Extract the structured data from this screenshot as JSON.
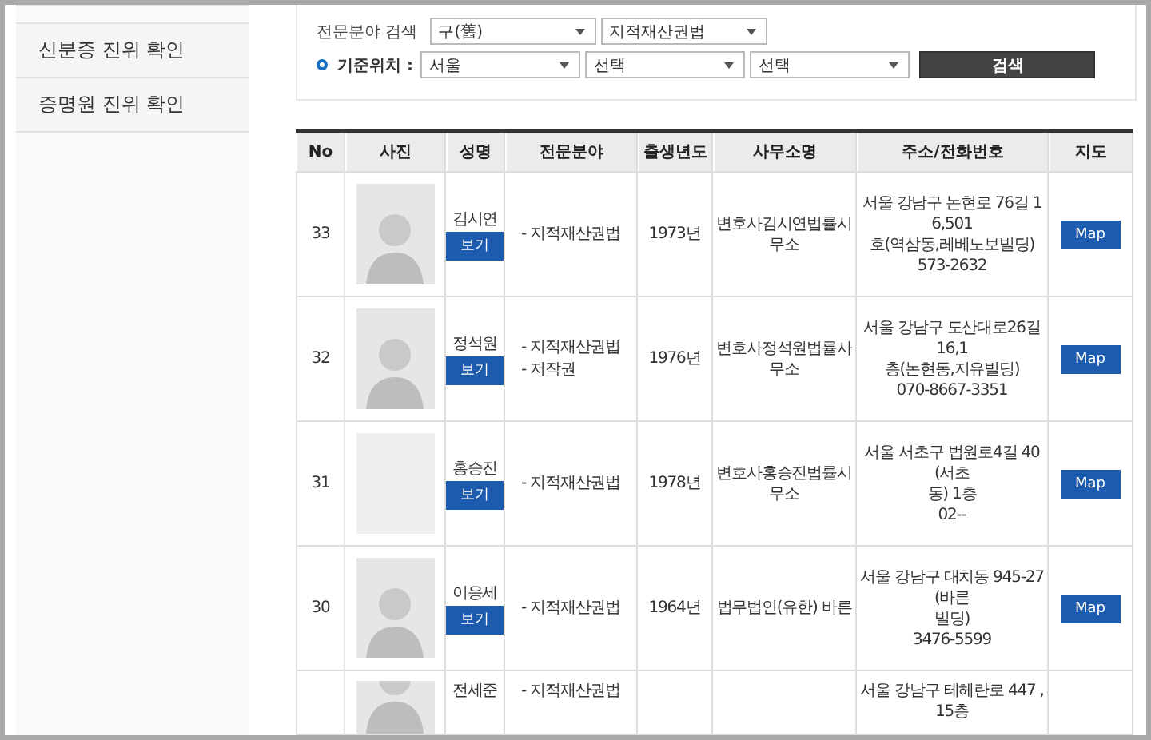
{
  "sidebar": {
    "items": [
      {
        "label": "신분증 진위 확인"
      },
      {
        "label": "증명원 진위 확인"
      }
    ]
  },
  "search": {
    "row_1": {
      "label": "전문분야 검색",
      "selects": [
        {
          "value": "구(舊)"
        },
        {
          "value": "지적재산권법"
        }
      ]
    },
    "row_2": {
      "label": "기준위치 :",
      "selects": [
        {
          "value": "서울"
        },
        {
          "value": "선택"
        },
        {
          "value": "선택"
        }
      ],
      "button": "검색"
    }
  },
  "table": {
    "columns": [
      "No",
      "사진",
      "성명",
      "전문분야",
      "출생년도",
      "사무소명",
      "주소/전화번호",
      "지도"
    ],
    "rows": [
      {
        "no": "33",
        "kind": "portrait",
        "name": "김시연",
        "view": "보기",
        "fields": [
          "-  지적재산권법"
        ],
        "year": "1973년",
        "office": "변호사김시연법률시무소",
        "address": [
          "서울 강남구 논현로 76길 16,501",
          "호(역삼동,레베노보빌딩)",
          "573-2632"
        ],
        "map": "Map"
      },
      {
        "no": "32",
        "kind": "portrait",
        "name": "정석원",
        "view": "보기",
        "fields": [
          "-  지적재산권법",
          "-  저작권"
        ],
        "year": "1976년",
        "office": "변호사정석원법률사무소",
        "address": [
          "서울 강남구 도산대로26길 16,1",
          "층(논현동,지유빌딩)",
          "070-8667-3351"
        ],
        "map": "Map"
      },
      {
        "no": "31",
        "kind": "logo",
        "name": "홍승진",
        "view": "보기",
        "fields": [
          "-  지적재산권법"
        ],
        "year": "1978년",
        "office": "변호사홍승진법률시무소",
        "address": [
          "서울 서초구 법원로4길 40 (서초",
          "동) 1층",
          "02--"
        ],
        "map": "Map"
      },
      {
        "no": "30",
        "kind": "portrait",
        "name": "이응세",
        "view": "보기",
        "fields": [
          "-  지적재산권법"
        ],
        "year": "1964년",
        "office": "법무법인(유한) 바른",
        "address": [
          "서울 강남구 대치동 945-27(바른",
          "빌딩)",
          "3476-5599"
        ],
        "map": "Map"
      },
      {
        "kind": "portrait",
        "name": "전세준",
        "fields": [
          "-  지적재산권법"
        ],
        "address": [
          "서울 강남구 테헤란로 447 , 15층"
        ]
      }
    ]
  }
}
